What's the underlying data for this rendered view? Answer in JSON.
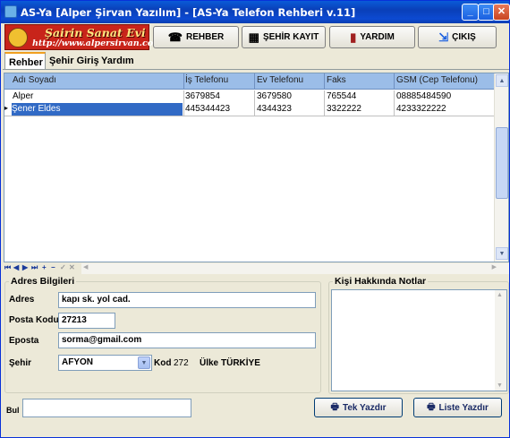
{
  "window": {
    "title": "AS-Ya [Alper Şirvan Yazılım] - [AS-Ya Telefon Rehberi v.11]"
  },
  "logo": {
    "line1": "Şairin Sanat Evi",
    "line2": "http://www.alpersirvan.com"
  },
  "toolbar": {
    "rehber_label": "REHBER",
    "sehir_kayit_label": "ŞEHİR KAYIT",
    "yardim_label": "YARDIM",
    "cikis_label": "ÇIKIŞ"
  },
  "tabs": [
    {
      "label": "Rehber",
      "active": true
    },
    {
      "label": "Şehir Giriş",
      "active": false
    },
    {
      "label": "Yardım",
      "active": false
    }
  ],
  "grid": {
    "columns": [
      "Adı Soyadı",
      "İş Telefonu",
      "Ev Telefonu",
      "Faks",
      "GSM (Cep Telefonu)"
    ],
    "rows": [
      [
        "Alper",
        "3679854",
        "3679580",
        "765544",
        "08885484590"
      ],
      [
        "Şener Eldes",
        "445344423",
        "4344323",
        "3322222",
        "4233322222"
      ]
    ],
    "selected_row": 1
  },
  "address": {
    "group_title": "Adres Bilgileri",
    "adres_label": "Adres",
    "adres_value": "kapı sk. yol cad.",
    "posta_label": "Posta Kodu",
    "posta_value": "27213",
    "eposta_label": "Eposta",
    "eposta_value": "sorma@gmail.com",
    "sehir_label": "Şehir",
    "sehir_value": "AFYON",
    "kod_label": "Kod",
    "kod_value": "272",
    "ulke_label": "Ülke",
    "ulke_value": "TÜRKİYE"
  },
  "notes": {
    "group_title": "Kişi Hakkında Notlar"
  },
  "bottom": {
    "bul_label": "Bul",
    "tek_yazdir_label": "Tek Yazdır",
    "liste_yazdir_label": "Liste Yazdır"
  },
  "icons": {
    "app": "app-icon",
    "rehber": "phonebook-icon",
    "sehir_kayit": "city-icon",
    "yardim": "book-icon",
    "cikis": "exit-icon",
    "print": "printer-icon"
  }
}
